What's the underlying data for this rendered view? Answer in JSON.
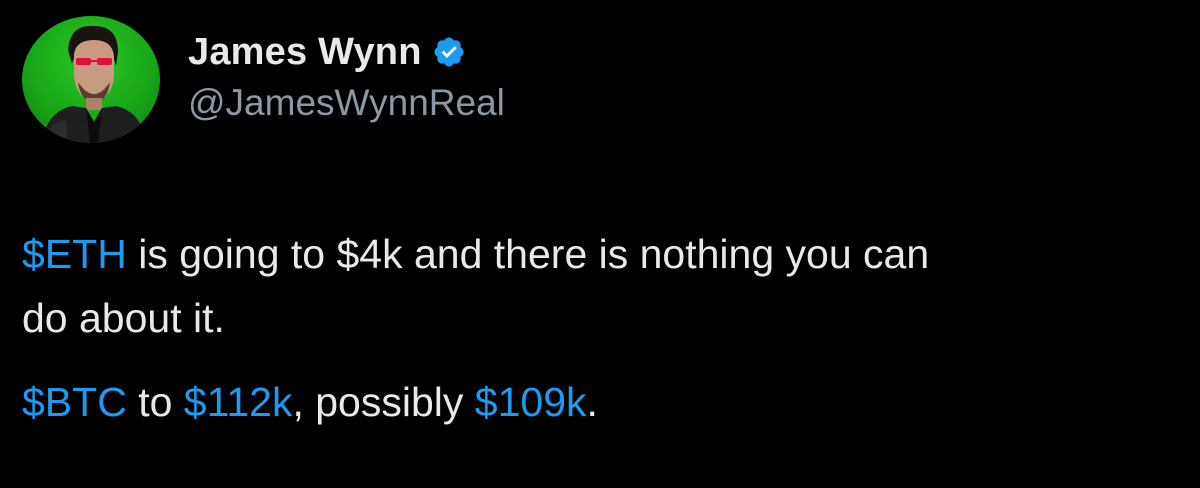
{
  "author": {
    "display_name": "James Wynn",
    "handle": "@JamesWynnReal",
    "verified": true,
    "verified_icon": "verified-badge-icon",
    "avatar_icon": "profile-avatar"
  },
  "tweet": {
    "line1": {
      "cashtag": "$ETH",
      "text": " is going to $4k and there is nothing you can"
    },
    "line2": {
      "text": "do about it."
    },
    "line3": {
      "cashtag1": "$BTC",
      "text1": " to ",
      "cashtag2": "$112k",
      "text2": ", possibly ",
      "cashtag3": "$109k",
      "text3": "."
    }
  },
  "colors": {
    "background": "#000000",
    "text": "#e7e9ea",
    "secondary_text": "#8b98a5",
    "accent": "#1d9bf0"
  }
}
